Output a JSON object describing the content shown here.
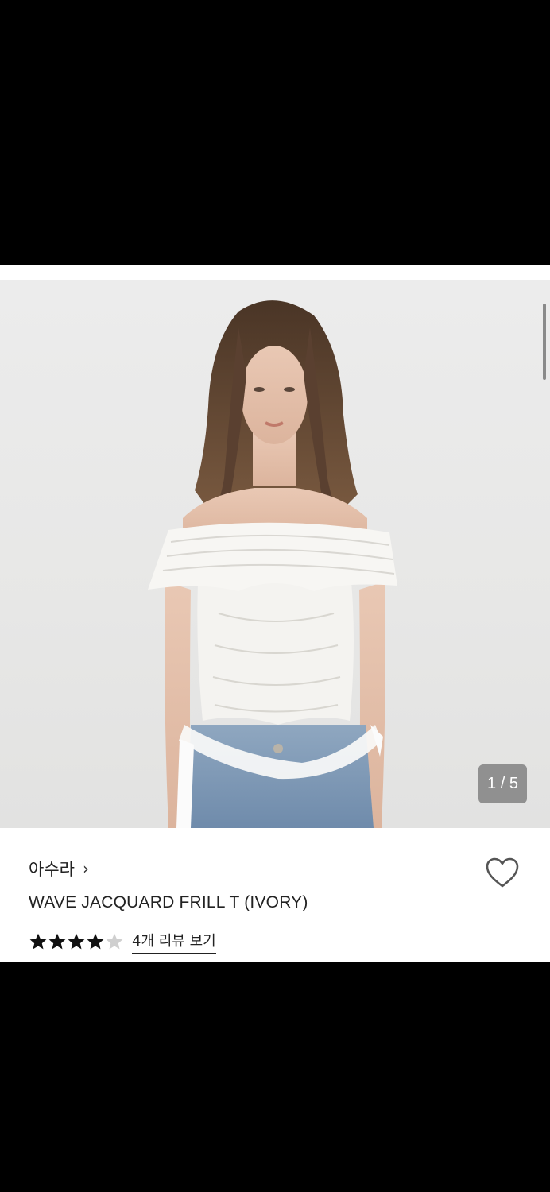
{
  "gallery": {
    "counter": "1 / 5",
    "current_index": 1,
    "total": 5
  },
  "product": {
    "brand": "아수라",
    "brand_chevron": "›",
    "title": "WAVE JACQUARD FRILL T (IVORY)",
    "rating": 4,
    "rating_max": 5,
    "review_link": "4개 리뷰 보기",
    "favorite_icon": "heart-outline-icon"
  },
  "colors": {
    "star_filled": "#111111",
    "star_empty": "#cfcfcf",
    "background_dark": "#000000"
  }
}
